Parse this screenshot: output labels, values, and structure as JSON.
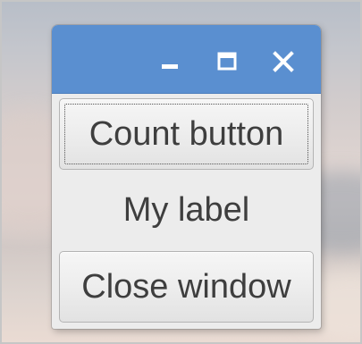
{
  "window": {
    "title": "",
    "controls": {
      "minimize_icon": "minimize-icon",
      "maximize_icon": "maximize-icon",
      "close_icon": "close-icon"
    }
  },
  "content": {
    "count_button_label": "Count button",
    "label_text": "My label",
    "close_button_label": "Close window"
  },
  "colors": {
    "titlebar": "#5a8fd0",
    "window_bg": "#ececec",
    "text": "#3e3e3e"
  }
}
